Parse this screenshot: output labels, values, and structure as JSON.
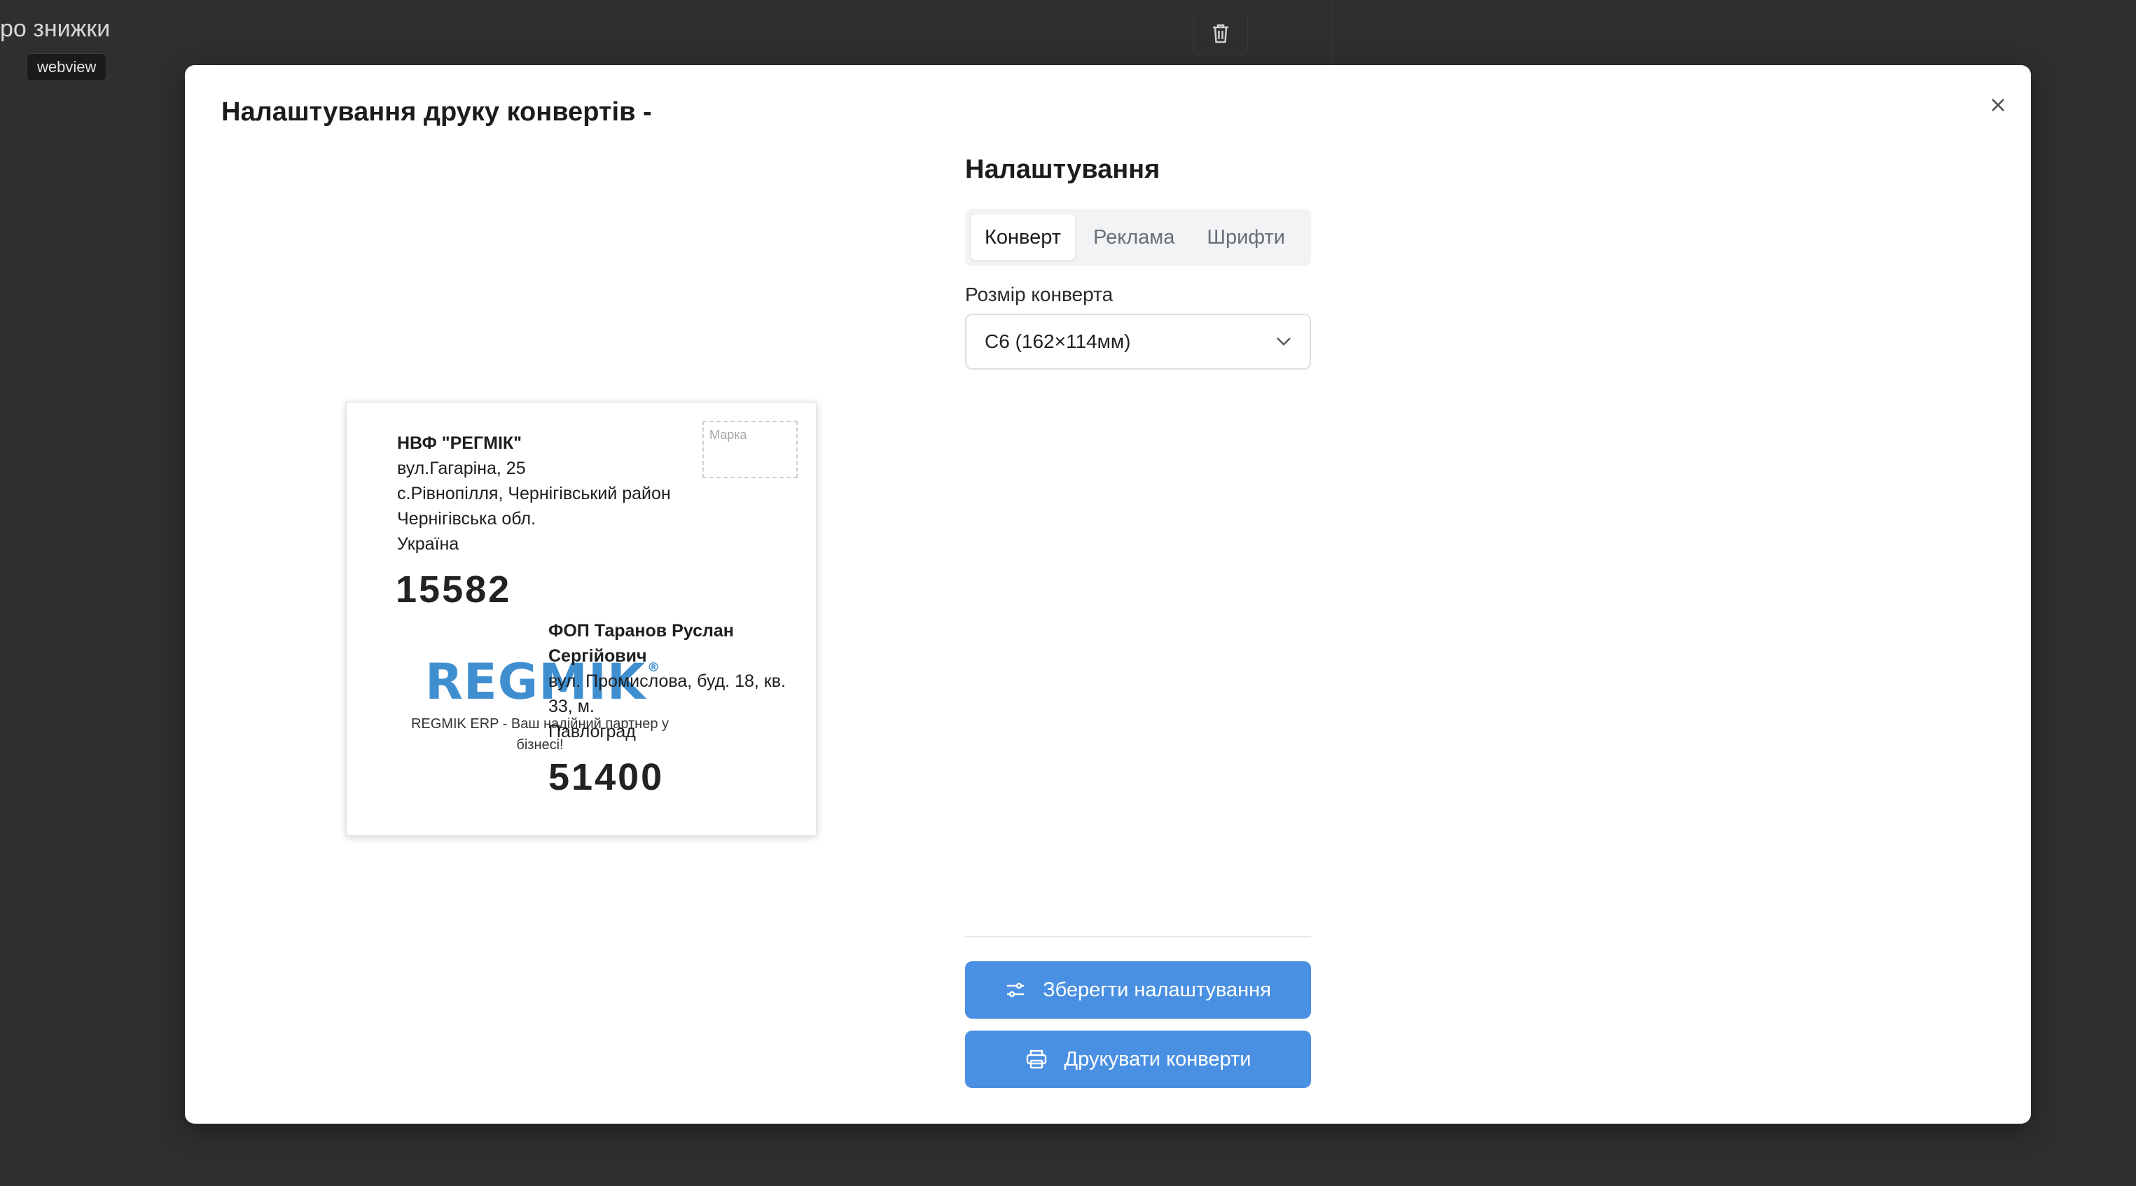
{
  "background": {
    "page_title": "ро знижки",
    "badge": "webview",
    "trash_icon": "trash-icon"
  },
  "modal": {
    "title": "Налаштування друку конвертів -",
    "close_icon": "close-icon"
  },
  "envelope": {
    "sender": {
      "name": "НВФ \"РЕГМІК\"",
      "line1": "вул.Гагаріна, 25",
      "line2": "с.Рівнопілля, Чернігівський район",
      "line3": "Чернігівська обл.",
      "line4": "Україна",
      "zip": "15582"
    },
    "stamp_label": "Марка",
    "recipient": {
      "name": "ФОП Таранов Руслан Сергійович",
      "line1": "вул. Промислова, буд. 18, кв. 33, м.",
      "line2": "Павлоград",
      "zip": "51400"
    },
    "logo_text": "REGMIK",
    "logo_mark": "®",
    "slogan": "REGMIK ERP - Ваш надійний партнер у бізнесі!"
  },
  "settings": {
    "title": "Налаштування",
    "tabs": [
      {
        "label": "Конверт",
        "active": true
      },
      {
        "label": "Реклама",
        "active": false
      },
      {
        "label": "Шрифти",
        "active": false
      }
    ],
    "size_label": "Розмір конверта",
    "size_value": "C6 (162×114мм)",
    "save_button": "Зберегти налаштування",
    "print_button": "Друкувати конверти"
  },
  "colors": {
    "primary": "#4a90e2",
    "overlay": "#2f2f2f",
    "logo": "#3f8fd0"
  }
}
